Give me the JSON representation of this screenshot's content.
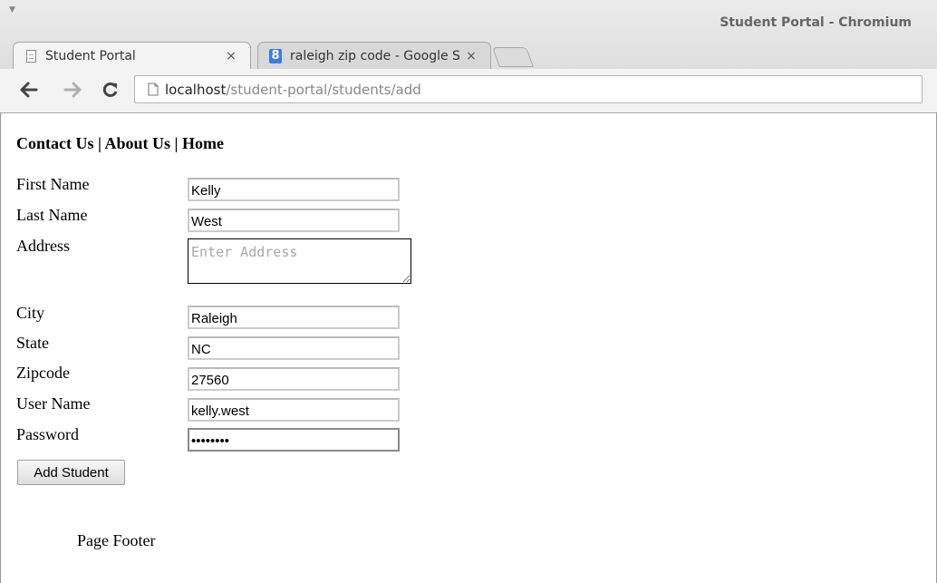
{
  "window": {
    "title": "Student Portal - Chromium",
    "menu_glyph": "▼"
  },
  "tabs": [
    {
      "label": "Student Portal",
      "icon": "page-icon",
      "close": "×",
      "active": true
    },
    {
      "label": "raleigh zip code - Google S",
      "icon": "google-icon",
      "icon_glyph": "8",
      "close": "×",
      "active": false
    }
  ],
  "toolbar": {
    "url_host": "localhost",
    "url_path": "/student-portal/students/add"
  },
  "nav": {
    "contact": "Contact Us",
    "about": "About Us",
    "home": "Home",
    "separator": " | "
  },
  "form": {
    "first_name": {
      "label": "First Name",
      "value": "Kelly"
    },
    "last_name": {
      "label": "Last Name",
      "value": "West"
    },
    "address": {
      "label": "Address",
      "placeholder": "Enter Address",
      "value": ""
    },
    "city": {
      "label": "City",
      "value": "Raleigh"
    },
    "state": {
      "label": "State",
      "value": "NC"
    },
    "zipcode": {
      "label": "Zipcode",
      "value": "27560"
    },
    "username": {
      "label": "User Name",
      "value": "kelly.west"
    },
    "password": {
      "label": "Password",
      "value": "••••••••"
    },
    "submit_label": "Add Student"
  },
  "footer": {
    "text": "Page Footer"
  },
  "colors": {
    "google_blue": "#3b7ce0",
    "chrome_bg": "#ebebeb",
    "title_text": "#666666"
  }
}
